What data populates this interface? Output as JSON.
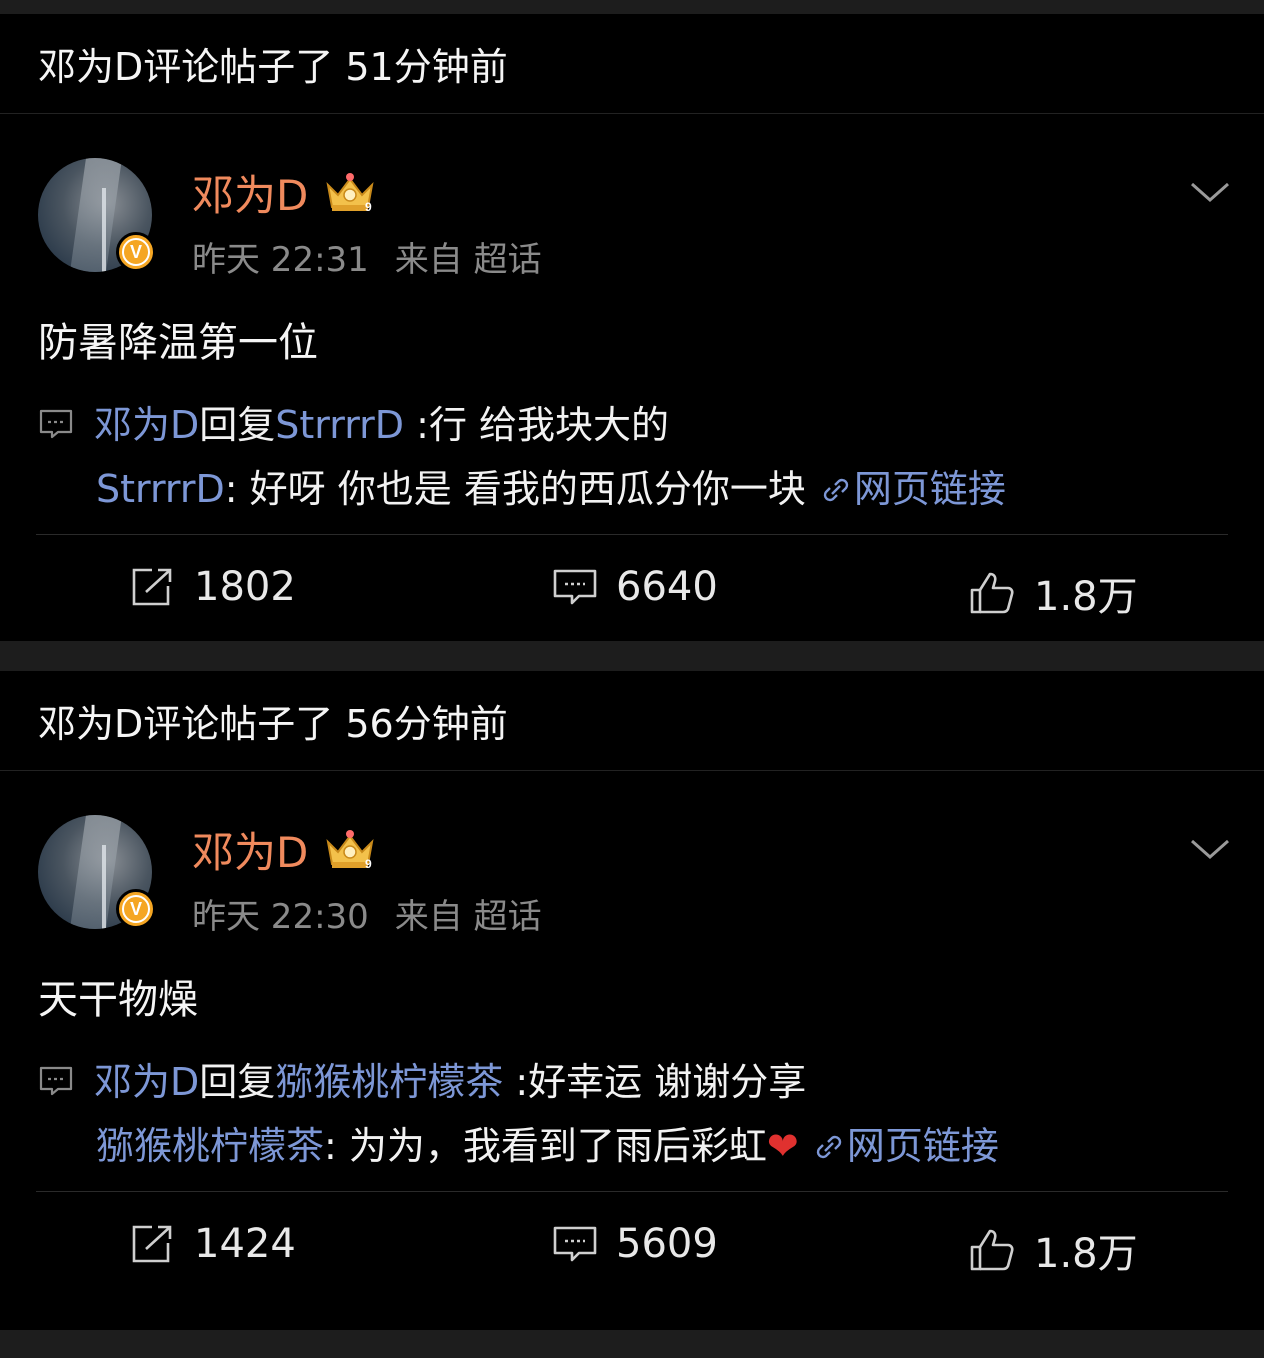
{
  "colors": {
    "background": "#000000",
    "username": "#f08a5d",
    "link": "#7d97d6",
    "meta": "#8a8a8a",
    "badge": "#f5a623"
  },
  "posts": [
    {
      "header": "邓为D评论帖子了 51分钟前",
      "username": "邓为D",
      "time": "昨天 22:31",
      "source": "来自 超话",
      "text": "防暑降温第一位",
      "reply_author": "邓为D",
      "reply_word": "回复",
      "reply_target": "StrrrrD",
      "reply_text": " :行 给我块大的",
      "quote_author": "StrrrrD",
      "quote_text": ": 好呀 你也是 看我的西瓜分你一块 ",
      "quote_emoji": "",
      "weblink": "网页链接",
      "shares": "1802",
      "comments": "6640",
      "likes": "1.8万"
    },
    {
      "header": "邓为D评论帖子了 56分钟前",
      "username": "邓为D",
      "time": "昨天 22:30",
      "source": "来自 超话",
      "text": "天干物燥",
      "reply_author": "邓为D",
      "reply_word": "回复",
      "reply_target": "猕猴桃柠檬茶",
      "reply_text": " :好幸运 谢谢分享",
      "quote_author": "猕猴桃柠檬茶",
      "quote_text": ": 为为，我看到了雨后彩虹",
      "quote_emoji": "❤",
      "weblink": "网页链接",
      "shares": "1424",
      "comments": "5609",
      "likes": "1.8万"
    }
  ],
  "icons": {
    "verified": "verified-v-badge",
    "crown": "crown-level-icon",
    "more": "chevron-down-icon",
    "comment_line": "comment-bubble-icon",
    "link": "link-icon",
    "share": "share-icon",
    "comment": "comment-icon",
    "like": "thumbs-up-icon"
  }
}
